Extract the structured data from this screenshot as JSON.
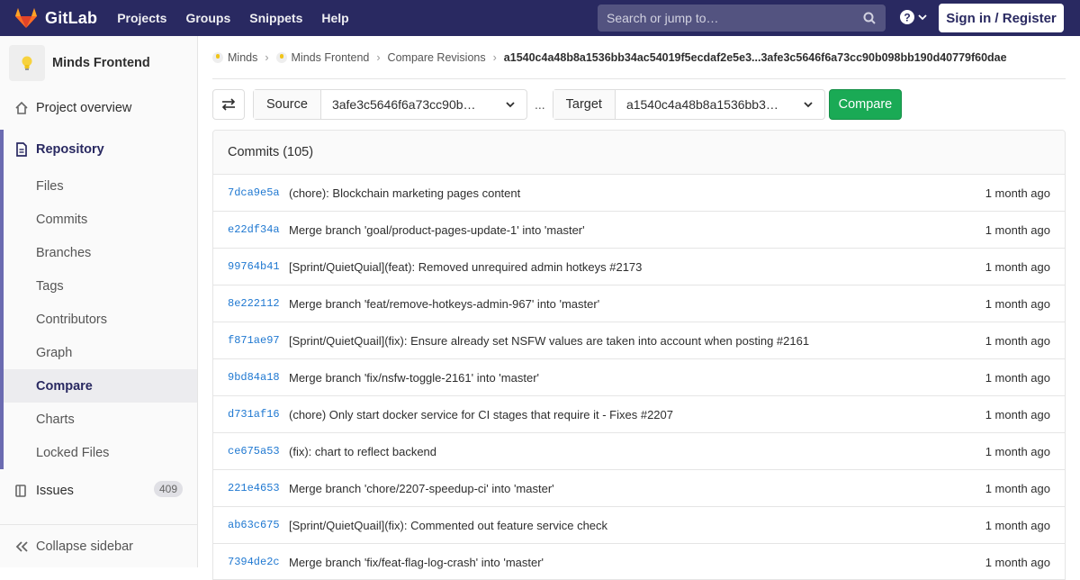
{
  "header": {
    "brand": "GitLab",
    "nav": [
      "Projects",
      "Groups",
      "Snippets",
      "Help"
    ],
    "search_placeholder": "Search or jump to…",
    "signin_label": "Sign in / Register"
  },
  "sidebar": {
    "project_name": "Minds Frontend",
    "overview_label": "Project overview",
    "repository_label": "Repository",
    "repo_items": [
      "Files",
      "Commits",
      "Branches",
      "Tags",
      "Contributors",
      "Graph",
      "Compare",
      "Charts",
      "Locked Files"
    ],
    "active_item": "Compare",
    "issues_label": "Issues",
    "issues_count": "409",
    "collapse_label": "Collapse sidebar"
  },
  "breadcrumb": {
    "group": "Minds",
    "project": "Minds Frontend",
    "section": "Compare Revisions",
    "current": "a1540c4a48b8a1536bb34ac54019f5ecdaf2e5e3...3afe3c5646f6a73cc90b098bb190d40779f60dae"
  },
  "compare": {
    "source_label": "Source",
    "source_value": "3afe3c5646f6a73cc90b…",
    "dots": "...",
    "target_label": "Target",
    "target_value": "a1540c4a48b8a1536bb3…",
    "button_label": "Compare"
  },
  "commits": {
    "header": "Commits (105)",
    "rows": [
      {
        "sha": "7dca9e5a",
        "message": "(chore): Blockchain marketing pages content",
        "time": "1 month ago"
      },
      {
        "sha": "e22df34a",
        "message": "Merge branch 'goal/product-pages-update-1' into 'master'",
        "time": "1 month ago"
      },
      {
        "sha": "99764b41",
        "message": "[Sprint/QuietQuial](feat): Removed unrequired admin hotkeys #2173",
        "time": "1 month ago"
      },
      {
        "sha": "8e222112",
        "message": "Merge branch 'feat/remove-hotkeys-admin-967' into 'master'",
        "time": "1 month ago"
      },
      {
        "sha": "f871ae97",
        "message": "[Sprint/QuietQuail](fix): Ensure already set NSFW values are taken into account when posting #2161",
        "time": "1 month ago"
      },
      {
        "sha": "9bd84a18",
        "message": "Merge branch 'fix/nsfw-toggle-2161' into 'master'",
        "time": "1 month ago"
      },
      {
        "sha": "d731af16",
        "message": "(chore) Only start docker service for CI stages that require it - Fixes #2207",
        "time": "1 month ago"
      },
      {
        "sha": "ce675a53",
        "message": "(fix): chart to reflect backend",
        "time": "1 month ago"
      },
      {
        "sha": "221e4653",
        "message": "Merge branch 'chore/2207-speedup-ci' into 'master'",
        "time": "1 month ago"
      },
      {
        "sha": "ab63c675",
        "message": "[Sprint/QuietQuail](fix): Commented out feature service check",
        "time": "1 month ago"
      },
      {
        "sha": "7394de2c",
        "message": "Merge branch 'fix/feat-flag-log-crash' into 'master'",
        "time": "1 month ago"
      }
    ]
  },
  "colors": {
    "topbar": "#292961",
    "accent": "#6b6bb1",
    "link": "#1f78d1",
    "success": "#1aaa55"
  }
}
